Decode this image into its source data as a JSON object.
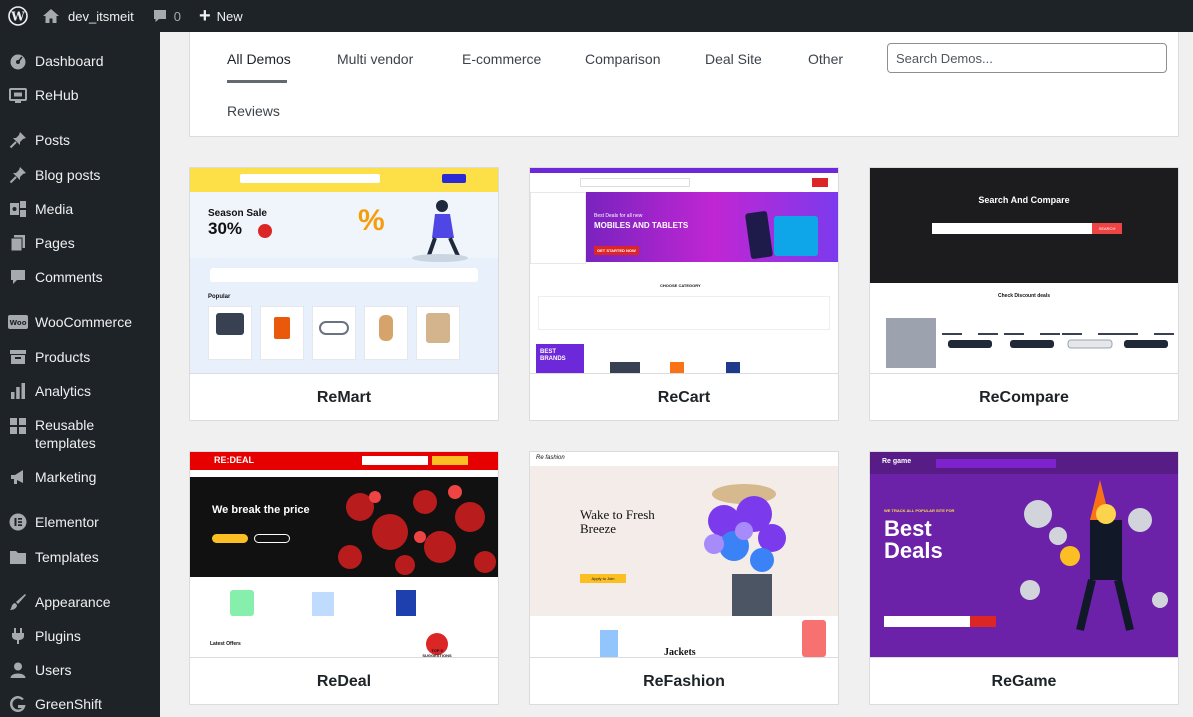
{
  "adminbar": {
    "site_name": "dev_itsmeit",
    "comments_count": "0",
    "new_label": "New"
  },
  "sidebar": {
    "items": [
      {
        "label": "Dashboard",
        "icon": "dashboard-icon"
      },
      {
        "label": "ReHub",
        "icon": "rehub-icon"
      },
      {
        "label": "Posts",
        "icon": "pin-icon"
      },
      {
        "label": "Blog posts",
        "icon": "pin-icon"
      },
      {
        "label": "Media",
        "icon": "media-icon"
      },
      {
        "label": "Pages",
        "icon": "pages-icon"
      },
      {
        "label": "Comments",
        "icon": "comment-icon"
      },
      {
        "label": "WooCommerce",
        "icon": "woo-icon"
      },
      {
        "label": "Products",
        "icon": "archive-icon"
      },
      {
        "label": "Analytics",
        "icon": "bar-chart-icon"
      },
      {
        "label": "Reusable templates",
        "icon": "grid-icon"
      },
      {
        "label": "Marketing",
        "icon": "megaphone-icon"
      },
      {
        "label": "Elementor",
        "icon": "elementor-icon"
      },
      {
        "label": "Templates",
        "icon": "folder-icon"
      },
      {
        "label": "Appearance",
        "icon": "brush-icon"
      },
      {
        "label": "Plugins",
        "icon": "plug-icon"
      },
      {
        "label": "Users",
        "icon": "user-icon"
      },
      {
        "label": "GreenShift",
        "icon": "greenshift-icon"
      }
    ]
  },
  "filters": {
    "tabs": [
      "All Demos",
      "Multi vendor",
      "E-commerce",
      "Comparison",
      "Deal Site",
      "Other",
      "Reviews"
    ],
    "active_tab": "All Demos",
    "search_placeholder": "Search Demos..."
  },
  "demos": [
    {
      "name": "ReMart",
      "hero": "Season Sale",
      "hero_value": "30%",
      "accent": "#fde047",
      "section_label": "Popular"
    },
    {
      "name": "ReCart",
      "hero": "MOBILES AND TABLETS",
      "hero_value": "Best Deals for all new",
      "accent": "#6d28d9",
      "section_label": "CHOOSE CATEGORY",
      "button": "GET STARTED NOW",
      "badge": "BEST BRANDS"
    },
    {
      "name": "ReCompare",
      "hero": "Search And Compare",
      "hero_value": "Check Discount deals",
      "accent": "#ef4444",
      "button": "SEARCH"
    },
    {
      "name": "ReDeal",
      "hero": "We break the price",
      "hero_value": "RE:DEAL",
      "accent": "#e60000",
      "section_label": "Latest Offers",
      "badge": "TOP 5 SUGGESTIONS"
    },
    {
      "name": "ReFashion",
      "hero": "Wake to Fresh Breeze",
      "hero_value": "Jackets",
      "accent": "#fbbf24",
      "button": "Apply to Join",
      "logo": "Re fashion"
    },
    {
      "name": "ReGame",
      "hero": "Best Deals",
      "hero_value": "WE TRACK ALL POPULAR SITE FOR",
      "accent": "#6b21a8",
      "logo": "Re game"
    }
  ]
}
